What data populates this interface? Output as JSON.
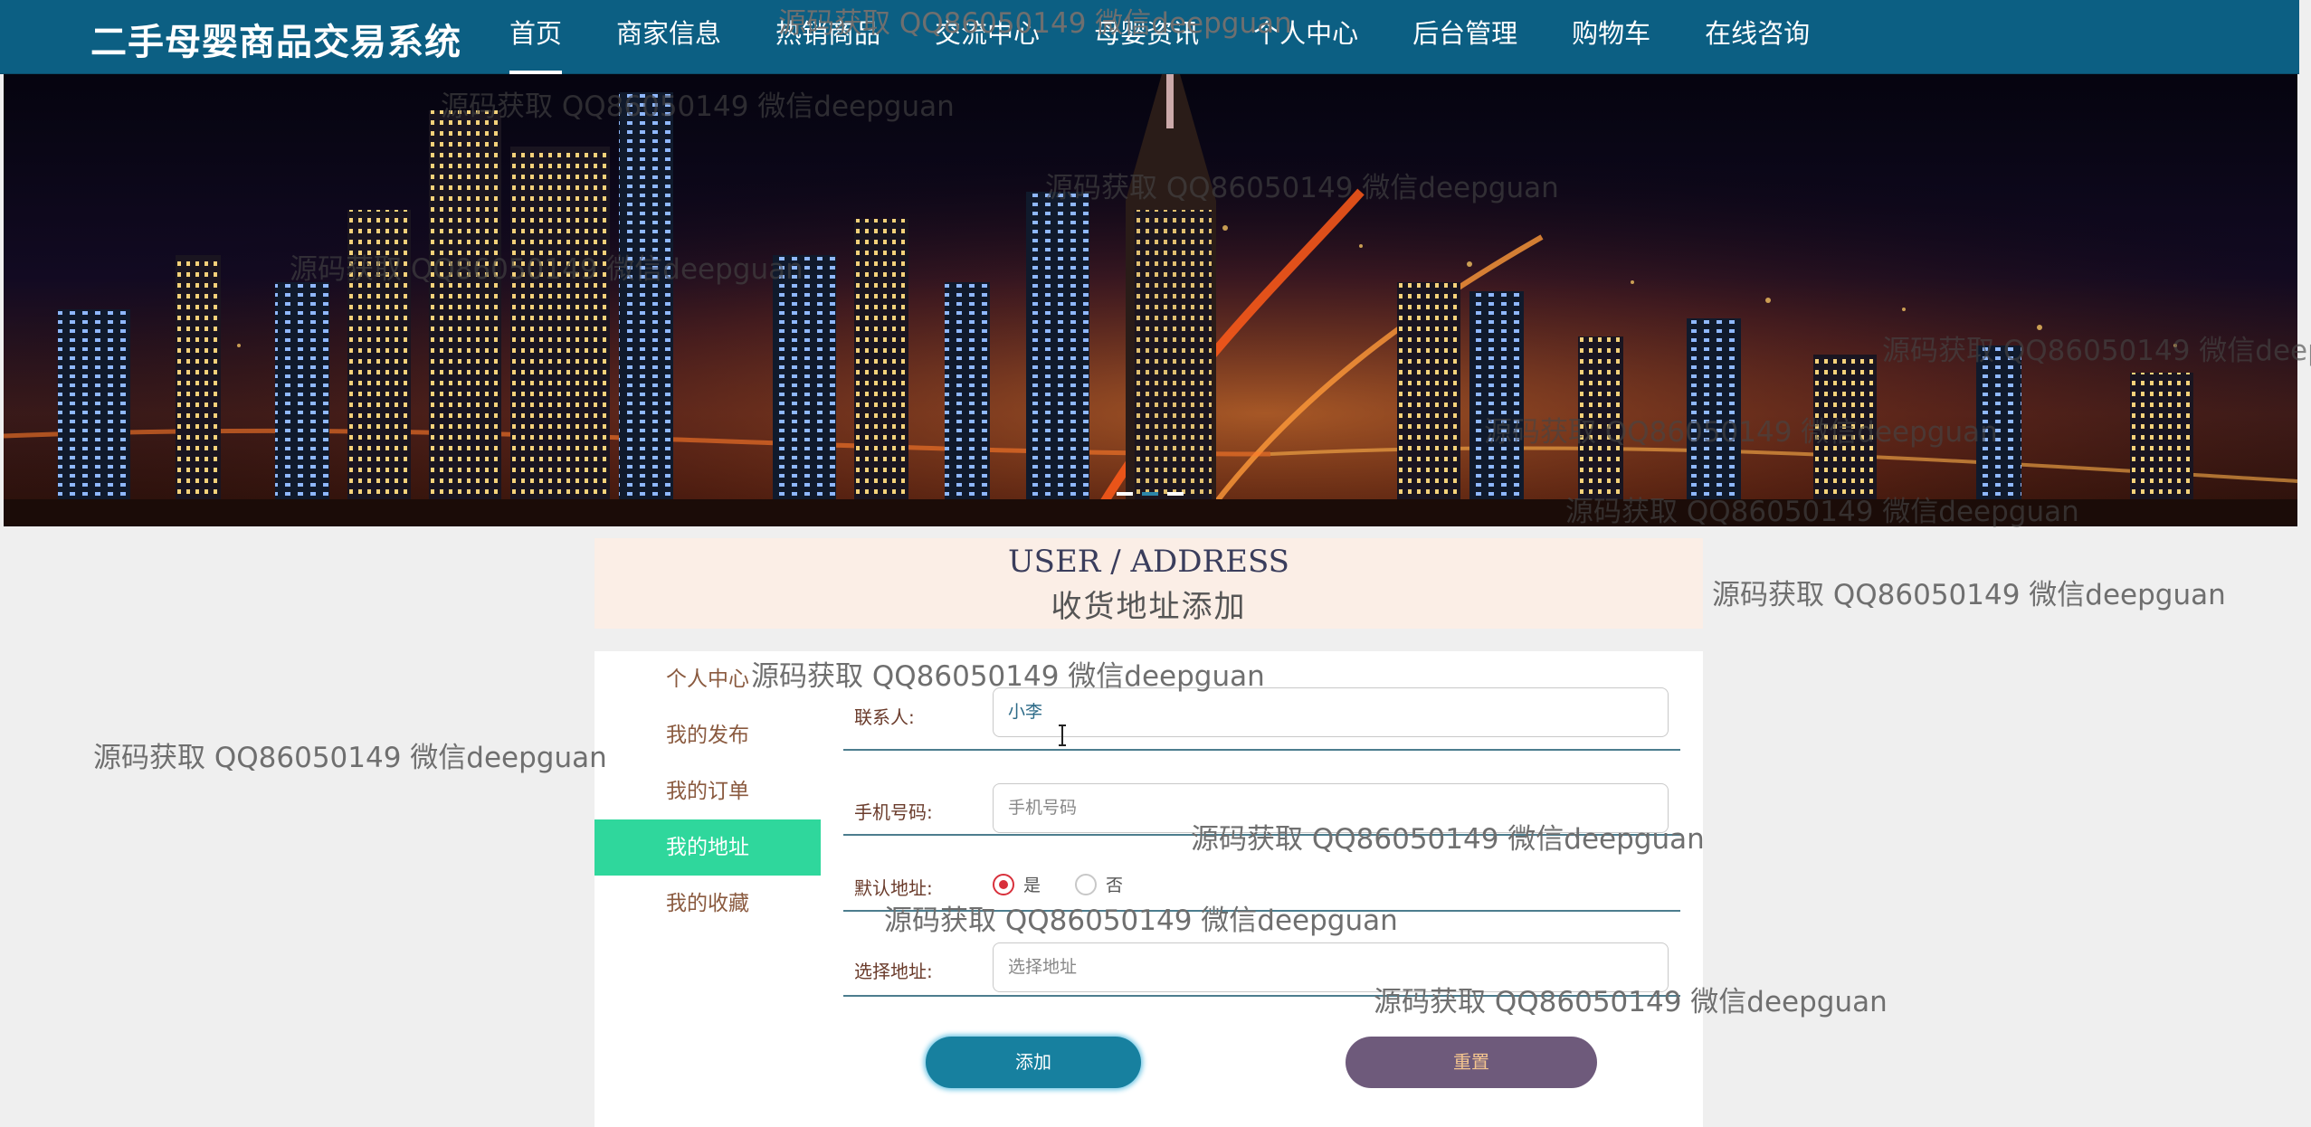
{
  "nav": {
    "brand": "二手母婴商品交易系统",
    "items": [
      {
        "label": "首页",
        "active": true
      },
      {
        "label": "商家信息"
      },
      {
        "label": "热销商品"
      },
      {
        "label": "交流中心"
      },
      {
        "label": "母婴资讯"
      },
      {
        "label": "个人中心"
      },
      {
        "label": "后台管理"
      },
      {
        "label": "购物车"
      },
      {
        "label": "在线咨询"
      }
    ]
  },
  "banner": {
    "slides": 3,
    "active_slide": 2,
    "scene": "night city skyline"
  },
  "section": {
    "title_en": "USER / ADDRESS",
    "title_cn": "收货地址添加"
  },
  "sidebar": {
    "items": [
      {
        "label": "个人中心"
      },
      {
        "label": "我的发布"
      },
      {
        "label": "我的订单"
      },
      {
        "label": "我的地址",
        "active": true
      },
      {
        "label": "我的收藏"
      }
    ]
  },
  "form": {
    "contact": {
      "label": "联系人:",
      "value": "小李"
    },
    "phone": {
      "label": "手机号码:",
      "placeholder": "手机号码"
    },
    "default": {
      "label": "默认地址:",
      "options": [
        "是",
        "否"
      ],
      "selected": "是"
    },
    "address": {
      "label": "选择地址:",
      "placeholder": "选择地址"
    },
    "add_button": "添加",
    "reset_button": "重置"
  },
  "watermark": "源码获取 QQ86050149 微信deepguan",
  "colors": {
    "nav": "#0c5f83",
    "accent_green": "#2fd79c",
    "add_button": "#17809f",
    "reset_button": "#6e5a7b",
    "radio_on": "#d8303b"
  }
}
